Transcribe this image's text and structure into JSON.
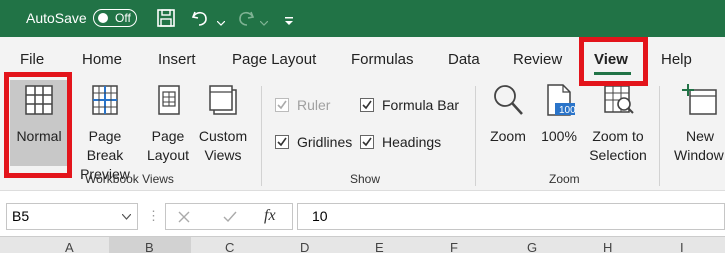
{
  "titlebar": {
    "autosave_label": "AutoSave",
    "autosave_state": "Off"
  },
  "tabs": [
    "File",
    "Home",
    "Insert",
    "Page Layout",
    "Formulas",
    "Data",
    "Review",
    "View",
    "Help"
  ],
  "active_tab": "View",
  "ribbon": {
    "workbook_views": {
      "label": "Workbook Views",
      "normal": "Normal",
      "page_break_1": "Page Break",
      "page_break_2": "Preview",
      "page_layout_1": "Page",
      "page_layout_2": "Layout",
      "custom_views_1": "Custom",
      "custom_views_2": "Views"
    },
    "show": {
      "label": "Show",
      "ruler": "Ruler",
      "formula_bar": "Formula Bar",
      "gridlines": "Gridlines",
      "headings": "Headings"
    },
    "zoom": {
      "label": "Zoom",
      "zoom": "Zoom",
      "zoom_100": "100%",
      "zoom_sel_1": "Zoom to",
      "zoom_sel_2": "Selection",
      "icon_100": "100"
    },
    "window": {
      "new_1": "New",
      "new_2": "Window"
    }
  },
  "formula_bar": {
    "name_box": "B5",
    "fx": "fx",
    "value": "10"
  },
  "columns": [
    "A",
    "B",
    "C",
    "D",
    "E",
    "F",
    "G",
    "H",
    "I"
  ],
  "colors": {
    "brand": "#217346",
    "highlight": "#e3141b",
    "accent_underline": "#217346"
  }
}
